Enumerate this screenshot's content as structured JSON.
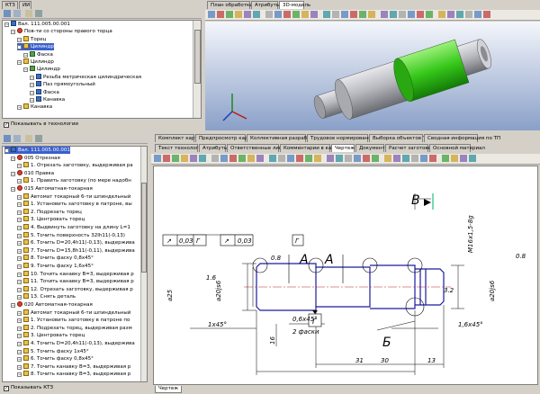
{
  "top_left_tabs": [
    {
      "label": "КТЗ"
    },
    {
      "label": "ИИ"
    }
  ],
  "top_tree": {
    "items": [
      {
        "label": "Вал. 111.005.00.001",
        "indent": 0
      },
      {
        "label": "Пов-ти со стороны правого торца",
        "indent": 1
      },
      {
        "label": "Торец",
        "indent": 2
      },
      {
        "label": "Цилиндр",
        "indent": 2,
        "selected": true
      },
      {
        "label": "Фаска",
        "indent": 3
      },
      {
        "label": "Цилиндр",
        "indent": 2
      },
      {
        "label": "Цилиндр",
        "indent": 3
      },
      {
        "label": "Резьба метрическая цилиндрическая",
        "indent": 4
      },
      {
        "label": "Паз прямоугольный",
        "indent": 4
      },
      {
        "label": "Фаска",
        "indent": 4
      },
      {
        "label": "Канавка",
        "indent": 4
      },
      {
        "label": "Канавка",
        "indent": 2
      }
    ],
    "show_in_tech_label": "Показывать в технологии"
  },
  "top_right_tabs": [
    {
      "label": "План обработки"
    },
    {
      "label": "Атрибуты"
    },
    {
      "label": "3D-модель",
      "selected": true
    }
  ],
  "bottom_tree": {
    "items": [
      {
        "label": "Вал. 111.005.00.001",
        "indent": 0,
        "selected": true
      },
      {
        "label": "005 Отрезная",
        "indent": 1
      },
      {
        "label": "1. Отрезать заготовку, выдерживая ра",
        "indent": 2
      },
      {
        "label": "010 Правка",
        "indent": 1
      },
      {
        "label": "1. Править заготовку (по мере надобн",
        "indent": 2
      },
      {
        "label": "015 Автоматная-токарная",
        "indent": 1
      },
      {
        "label": "Автомат токарный 6-ти шпиндельный",
        "indent": 2
      },
      {
        "label": "1. Установить заготовку в патроне, вы",
        "indent": 2
      },
      {
        "label": "2. Подрезать торец",
        "indent": 2
      },
      {
        "label": "3. Центровать торец",
        "indent": 2
      },
      {
        "label": "4. Выдвинуть заготовку на длину  L=1",
        "indent": 2
      },
      {
        "label": "5. Точить поверхность 32Ih11(-0,13)",
        "indent": 2
      },
      {
        "label": "6. Точить D=20,4h11(-0,13), выдержива",
        "indent": 2
      },
      {
        "label": "7. Точить D=15,8h11(-0,11), выдержива",
        "indent": 2
      },
      {
        "label": "8. Точить фаску 0,8x45°",
        "indent": 2
      },
      {
        "label": "9. Точить фаску 1,6x45°",
        "indent": 2
      },
      {
        "label": "10. Точить канавку В=3, выдерживая р",
        "indent": 2
      },
      {
        "label": "11. Точить канавку В=3, выдерживая р",
        "indent": 2
      },
      {
        "label": "12. Отрезать заготовку, выдерживая р",
        "indent": 2
      },
      {
        "label": "13. Снять деталь",
        "indent": 2
      },
      {
        "label": "020 Автоматная-токарная",
        "indent": 1
      },
      {
        "label": "Автомат токарный 6-ти шпиндельный",
        "indent": 2
      },
      {
        "label": "1. Установить заготовку в патроне по",
        "indent": 2
      },
      {
        "label": "2. Подрезать торец, выдерживая разм",
        "indent": 2
      },
      {
        "label": "3. Центровать торец",
        "indent": 2
      },
      {
        "label": "4. Точить D=20,4h11(-0,13), выдержива",
        "indent": 2
      },
      {
        "label": "5. Точить фаску 1x45°",
        "indent": 2
      },
      {
        "label": "6. Точить фаску 0,8x45°",
        "indent": 2
      },
      {
        "label": "7. Точить канавку В=3, выдерживая р",
        "indent": 2
      },
      {
        "label": "8. Точить канавку В=3, выдерживая р",
        "indent": 2
      }
    ],
    "show_kt3_label": "Показывать КТЗ"
  },
  "bottom_tabs_row1": [
    {
      "label": "Комплект карт"
    },
    {
      "label": "Предпросмотр карт"
    },
    {
      "label": "Коллективная разработка"
    },
    {
      "label": "Трудовое нормирование"
    },
    {
      "label": "Выборка объектов ТП"
    },
    {
      "label": "Сводная информация по ТП"
    }
  ],
  "bottom_tabs_row2": [
    {
      "label": "Текст технолога"
    },
    {
      "label": "Атрибуты"
    },
    {
      "label": "Ответственные лица"
    },
    {
      "label": "Комментарии в карты"
    },
    {
      "label": "Чертеж",
      "selected": true
    },
    {
      "label": "Документы"
    },
    {
      "label": "Расчет заготовки"
    },
    {
      "label": "Основной материал"
    }
  ],
  "drawing": {
    "section_B": "B",
    "section_A1": "A",
    "section_A2": "A",
    "label_B_bottom": "Б",
    "label_G_top": "Г",
    "label_G_box": "Г",
    "tol1_val": "0,03",
    "tol1_ref": "Г",
    "tol2_val": "0,03",
    "rough_1_6": "1.6",
    "rough_0_8a": "0.8",
    "rough_0_8b": "0.8",
    "rough_3_2": "3.2",
    "d25": "⌀25",
    "d20js6a": "⌀20js6",
    "d20js6b": "⌀20js6",
    "thread": "M16x1,5-8g",
    "cham1": "1x45°",
    "cham2": "0,6x45°",
    "cham2_note": "2 фаски",
    "cham3": "1,6x45°",
    "dim16": "16",
    "dim31": "31",
    "dim30": "30",
    "dim13": "13"
  },
  "bottom_drawing_tab": "Чертеж"
}
